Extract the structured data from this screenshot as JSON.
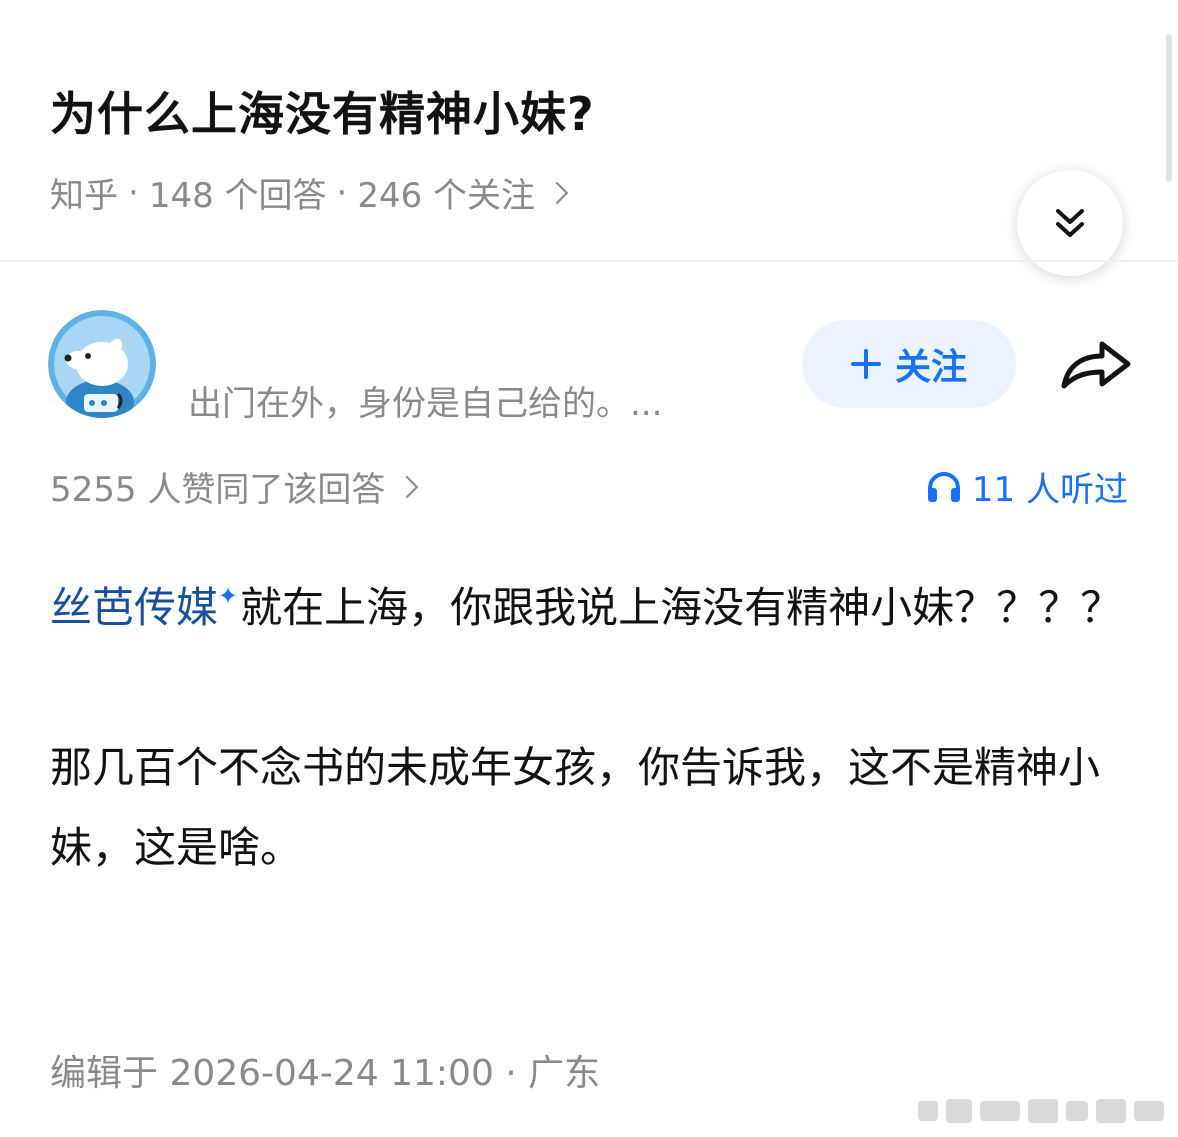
{
  "question": {
    "title": "为什么上海没有精神小妹?",
    "source": "知乎",
    "answers_count": "148 个回答",
    "followers_count": "246 个关注",
    "separator": "·"
  },
  "author": {
    "bio": "出门在外，身份是自己给的。...",
    "follow_label": "关注"
  },
  "stats": {
    "upvote_text": "5255 人赞同了该回答",
    "listen_text": "11 人听过"
  },
  "answer": {
    "mention": "丝芭传媒",
    "paragraph1_rest": "就在上海，你跟我说上海没有精神小妹？？？？",
    "paragraph2": "那几百个不念书的未成年女孩，你告诉我，这不是精神小妹，这是啥。"
  },
  "footer": {
    "edit_info": "编辑于 2026-04-24 11:00 · 广东"
  },
  "colors": {
    "accent": "#1772f6",
    "mention": "#1a4f9c",
    "meta_gray": "#8a8a8a",
    "follow_bg": "#ebf3ff"
  },
  "icons": {
    "collapse": "double-chevron-down-icon",
    "share": "share-arrow-icon",
    "listen": "headphones-icon",
    "follow": "plus-icon",
    "mention_mark": "sparkle-icon"
  }
}
